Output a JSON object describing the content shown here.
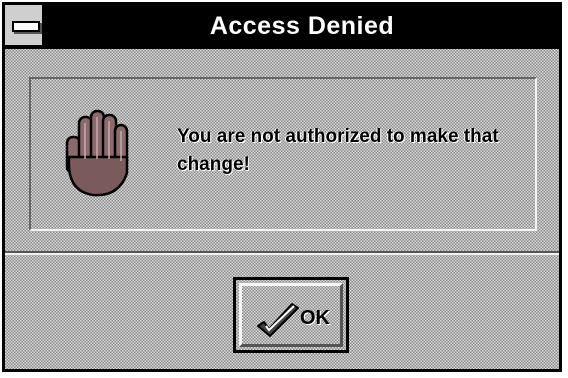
{
  "dialog": {
    "title": "Access Denied",
    "message": "You are not authorized to make that change!",
    "ok_label": "OK"
  },
  "icons": {
    "system_menu": "system-menu-icon",
    "message": "stop-hand-icon",
    "ok": "checkmark-icon"
  },
  "colors": {
    "title_bar": "#000000",
    "title_text": "#ffffff",
    "dialog_face": "#bdbdbd"
  }
}
